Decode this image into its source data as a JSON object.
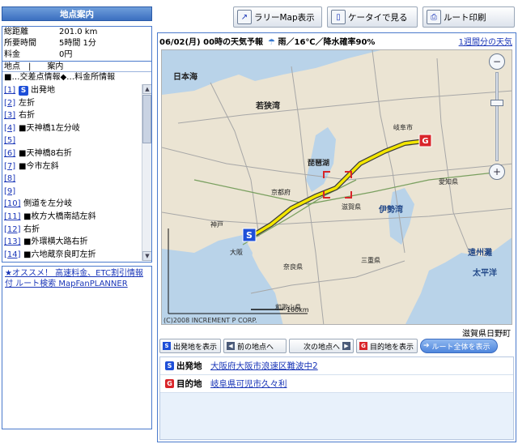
{
  "left": {
    "header": "地点案内",
    "summary": [
      {
        "key": "総距離",
        "value": "201.0 km"
      },
      {
        "key": "所要時間",
        "value": "5時間 1分"
      },
      {
        "key": "料金",
        "value": "0円"
      }
    ],
    "list_header": "地点　|　　案内",
    "legend": "■…交差点情報◆…料金所情報",
    "waypoints": [
      {
        "num": "[1]",
        "mark": "S",
        "text": "出発地"
      },
      {
        "num": "[2]",
        "mark": "",
        "text": "左折"
      },
      {
        "num": "[3]",
        "mark": "",
        "text": "右折"
      },
      {
        "num": "[4]",
        "mark": "",
        "text": "■天神橋1左分岐"
      },
      {
        "num": "[5]",
        "mark": "",
        "text": ""
      },
      {
        "num": "[6]",
        "mark": "",
        "text": "■天神橋8右折"
      },
      {
        "num": "[7]",
        "mark": "",
        "text": "■今市左斜"
      },
      {
        "num": "[8]",
        "mark": "",
        "text": ""
      },
      {
        "num": "[9]",
        "mark": "",
        "text": ""
      },
      {
        "num": "[10]",
        "mark": "",
        "text": "側道を左分岐"
      },
      {
        "num": "[11]",
        "mark": "",
        "text": "■枚方大橋南詰左斜"
      },
      {
        "num": "[12]",
        "mark": "",
        "text": "右折"
      },
      {
        "num": "[13]",
        "mark": "",
        "text": "■外環横大路右折"
      },
      {
        "num": "[14]",
        "mark": "",
        "text": "■六地蔵奈良町左折"
      }
    ],
    "ad_text": "★オススメ！ 高速料金、ETC割引情報付 ルート検索 MapFanPLANNER"
  },
  "top_buttons": {
    "rally": "ラリーMap表示",
    "mobile": "ケータイで見る",
    "print": "ルート印刷"
  },
  "weather": {
    "date": "06/02(月) 00時の天気予報",
    "condition": "雨／16℃／降水確率90%",
    "weekly_link": "1週間分の天気"
  },
  "map": {
    "labels": {
      "sea": "日本海",
      "bay": "若狭湾",
      "lake": "琵琶湖",
      "kyoto": "京都府",
      "shiga": "滋賀県",
      "gifu_city": "岐阜市",
      "aichi": "愛知県",
      "ise": "伊勢湾",
      "mie": "三重県",
      "nara": "奈良県",
      "osaka": "大阪",
      "wakayama": "和歌山県",
      "enshu": "遠州灘",
      "pacific": "太平洋",
      "kobe": "神戸",
      "scale": "100km"
    },
    "copyright": "(C)2008 INCREMENT P CORP.",
    "place": "滋賀県日野町"
  },
  "controls": {
    "show_start": "出発地を表示",
    "prev": "前の地点へ",
    "next": "次の地点へ",
    "show_goal": "目的地を表示",
    "show_all": "ルート全体を表示"
  },
  "route": {
    "start_label": "出発地",
    "start_value": "大阪府大阪市浪速区難波中2",
    "goal_label": "目的地",
    "goal_value": "岐阜県可児市久々利"
  },
  "colors": {
    "accent": "#3b6fc0",
    "start_mark": "#1e4fd8",
    "goal_mark": "#d9252a",
    "route": "#f3e600"
  }
}
